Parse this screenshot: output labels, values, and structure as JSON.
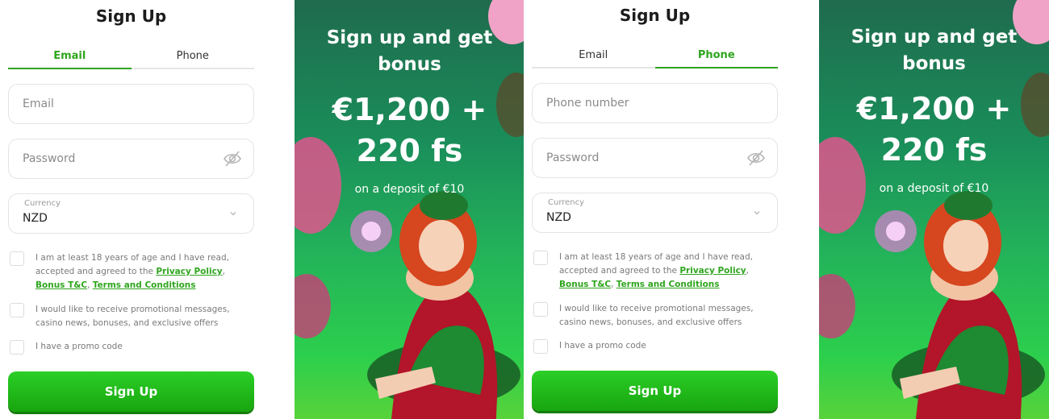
{
  "email_form": {
    "title": "Sign Up",
    "tabs": [
      {
        "label": "Email",
        "active": true
      },
      {
        "label": "Phone",
        "active": false
      }
    ],
    "first_field_placeholder": "Email",
    "password_placeholder": "Password",
    "currency_label": "Currency",
    "currency_value": "NZD",
    "terms_text_prefix": "I am at least 18 years of age and I have read, accepted and agreed to the ",
    "privacy_link": "Privacy Policy",
    "separator": ", ",
    "bonus_link": "Bonus T&C",
    "terms_link": "Terms and Conditions",
    "promo_messages_text": "I would like to receive promotional messages, casino news, bonuses, and exclusive offers",
    "promo_code_text": "I have a promo code",
    "submit_label": "Sign Up"
  },
  "phone_form": {
    "title": "Sign Up",
    "tabs": [
      {
        "label": "Email",
        "active": false
      },
      {
        "label": "Phone",
        "active": true
      }
    ],
    "first_field_placeholder": "Phone number",
    "password_placeholder": "Password",
    "currency_label": "Currency",
    "currency_value": "NZD",
    "terms_text_prefix": "I am at least 18 years of age and I have read, accepted and agreed to the ",
    "privacy_link": "Privacy Policy",
    "separator": ", ",
    "bonus_link": "Bonus T&C",
    "terms_link": "Terms and Conditions",
    "promo_messages_text": "I would like to receive promotional messages, casino news, bonuses, and exclusive offers",
    "promo_code_text": "I have a promo code",
    "submit_label": "Sign Up"
  },
  "promo": {
    "headline": "Sign up and get bonus",
    "amount": "€1,200 +",
    "spins": "220 fs",
    "deposit_note": "on a deposit of €10"
  },
  "colors": {
    "accent": "#2fa51e",
    "button": "#1fb818",
    "promo_bg": "#1f9a55"
  },
  "icons": [
    "eye-off-icon",
    "chevron-down-icon"
  ]
}
